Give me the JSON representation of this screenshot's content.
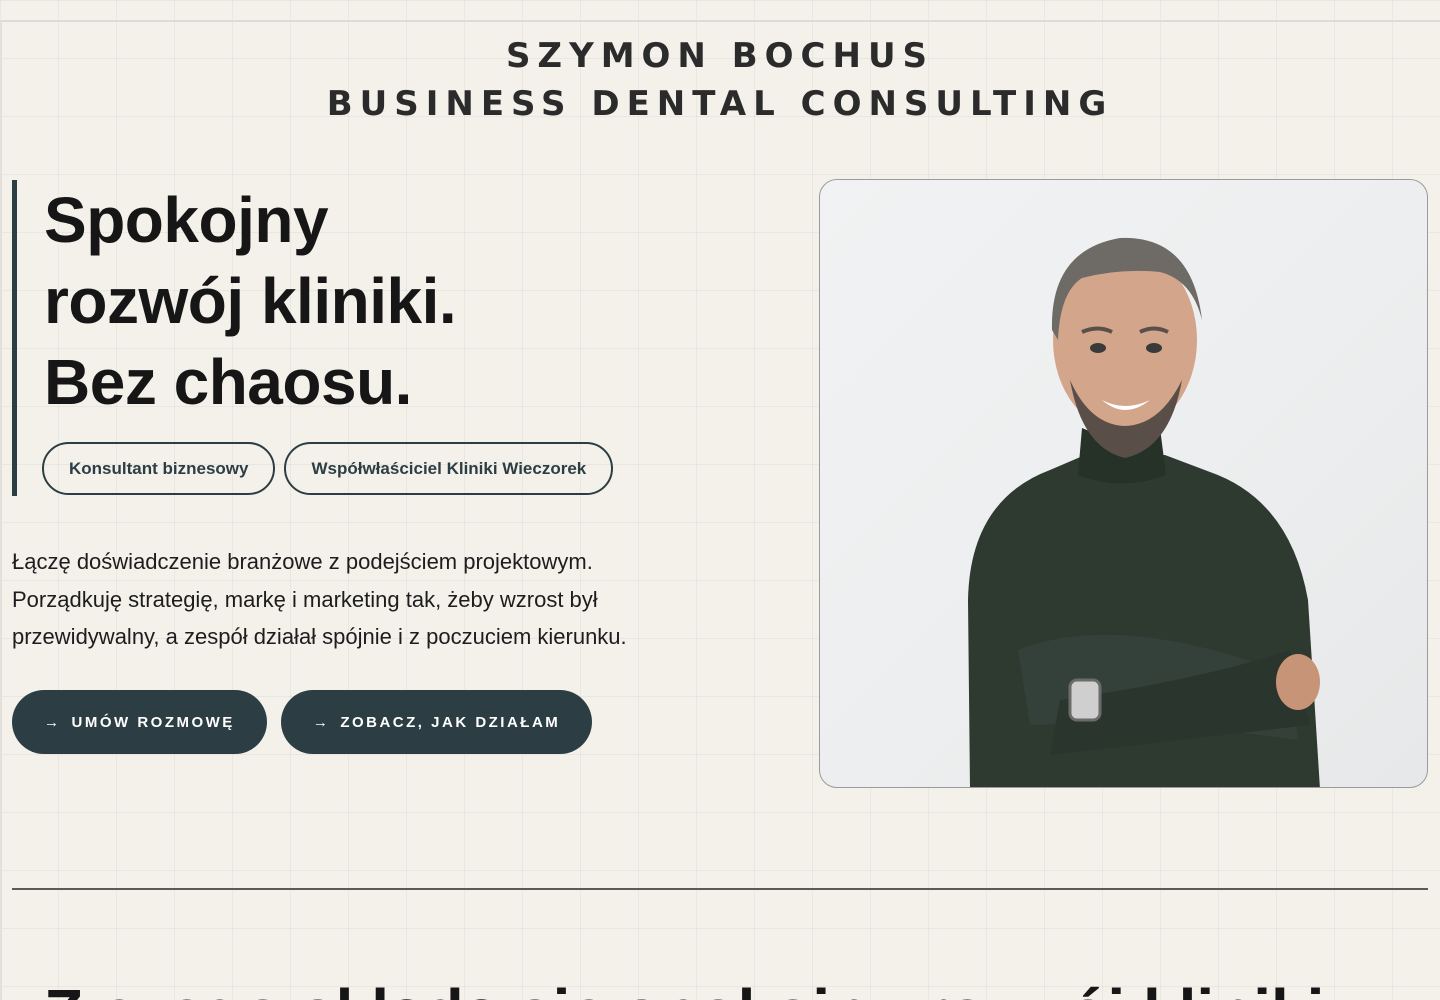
{
  "brand": {
    "line1": "SZYMON BOCHUS",
    "line2": "BUSINESS DENTAL CONSULTING"
  },
  "hero": {
    "headline": [
      "Spokojny",
      "rozwój kliniki.",
      "Bez chaosu."
    ],
    "tags": [
      "Konsultant biznesowy",
      "Współwłaściciel Kliniki Wieczorek"
    ],
    "intro": [
      "Łączę doświadczenie branżowe z podejściem projektowym.",
      "Porządkuję strategię, markę i marketing tak, żeby wzrost był",
      "przewidywalny, a zespół działał spójnie i z poczuciem kierunku."
    ],
    "cta_primary": "UMÓW ROZMOWĘ",
    "cta_secondary": "ZOBACZ, JAK DZIAŁAM",
    "cta_icon": "arrow-right-icon"
  },
  "next_section": {
    "heading": "Z czego składa się spokojny rozwój kliniki"
  },
  "colors": {
    "background": "#f4f1eb",
    "accent": "#2c3e44",
    "text": "#1c1c1c"
  }
}
